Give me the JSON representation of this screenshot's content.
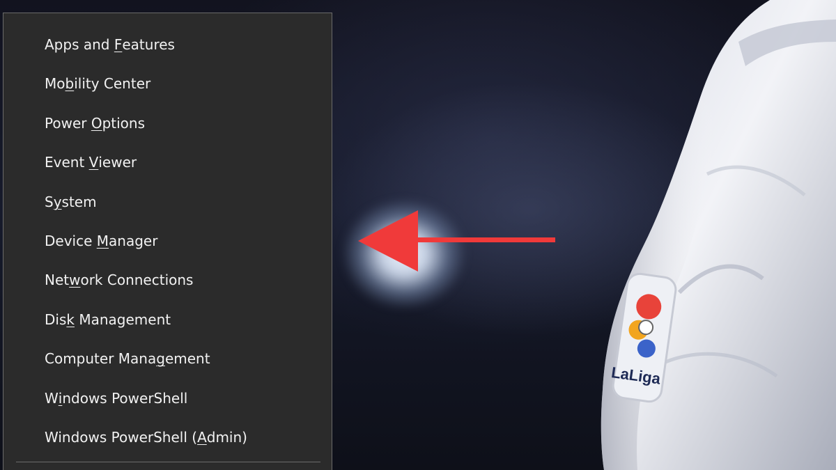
{
  "context_menu": {
    "items": [
      {
        "pre": "Apps and ",
        "key": "F",
        "post": "eatures"
      },
      {
        "pre": "Mo",
        "key": "b",
        "post": "ility Center"
      },
      {
        "pre": "Power ",
        "key": "O",
        "post": "ptions"
      },
      {
        "pre": "Event ",
        "key": "V",
        "post": "iewer"
      },
      {
        "pre": "S",
        "key": "y",
        "post": "stem"
      },
      {
        "pre": "Device ",
        "key": "M",
        "post": "anager"
      },
      {
        "pre": "Net",
        "key": "w",
        "post": "ork Connections"
      },
      {
        "pre": "Dis",
        "key": "k",
        "post": " Management"
      },
      {
        "pre": "Computer Mana",
        "key": "g",
        "post": "ement"
      },
      {
        "pre": "W",
        "key": "i",
        "post": "ndows PowerShell"
      },
      {
        "pre": "Windows PowerShell (",
        "key": "A",
        "post": "dmin)"
      }
    ]
  },
  "annotation": {
    "arrow_icon": "red-arrow-left-icon",
    "arrow_color": "#f03a3a",
    "points_to": "Device Manager"
  },
  "background": {
    "badge_text": "LaLiga",
    "colors": {
      "menu_bg": "#2b2b2b",
      "menu_text": "#f2f2f2",
      "scene_dark": "#12131f"
    }
  }
}
